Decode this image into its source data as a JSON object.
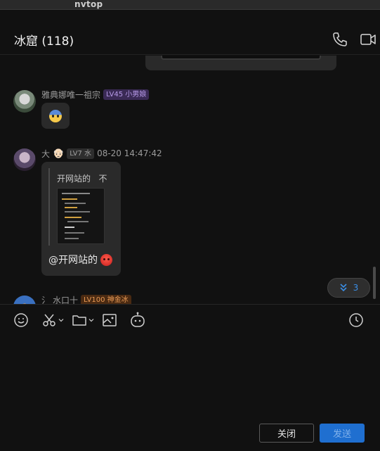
{
  "window": {
    "app_title": "nvtop"
  },
  "header": {
    "title": "冰窟 (118)",
    "phone_icon": "phone-icon",
    "video_icon": "video-camera-icon"
  },
  "messages": [
    {
      "sender": "雅典娜唯一祖宗",
      "level_badge": "LV45 小男娘",
      "content_emoji": "fearful-face-emoji"
    },
    {
      "sender": "大",
      "sender_emoji": "👴🏻",
      "level_badge": "LV7 水",
      "timestamp": "08-20 14:47:42",
      "quote_text": "开网站的",
      "quote_suffix": "不",
      "text": "@开网站的",
      "text_emoji": "angry-face-emoji"
    },
    {
      "sender": "水口十",
      "sender_prefix": "氵",
      "level_badge": "LV100 神金冰"
    }
  ],
  "unread": {
    "count": "3",
    "icon": "double-chevron-down-icon"
  },
  "toolbar": {
    "icons": [
      "smile-icon",
      "scissors-icon",
      "folder-icon",
      "image-icon",
      "robot-icon",
      "clock-icon"
    ]
  },
  "buttons": {
    "close_label": "关闭",
    "send_label": "发送"
  },
  "colors": {
    "accent": "#1f6fd0",
    "background": "#111111",
    "bubble": "#2a2a2a"
  }
}
